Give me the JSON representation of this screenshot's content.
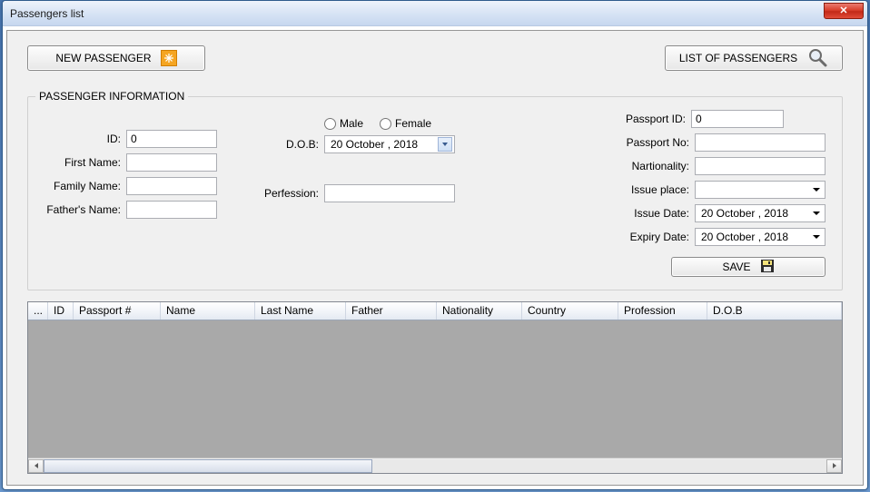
{
  "window": {
    "title": "Passengers list"
  },
  "toolbar": {
    "new_passenger": "NEW PASSENGER",
    "list_of_passengers": "LIST OF PASSENGERS"
  },
  "group": {
    "title": "PASSENGER INFORMATION"
  },
  "labels": {
    "id": "ID:",
    "first_name": "First Name:",
    "family_name": "Family Name:",
    "fathers_name": "Father's Name:",
    "dob": "D.O.B:",
    "profession": "Perfession:",
    "male": "Male",
    "female": "Female",
    "passport_id": "Passport ID:",
    "passport_no": "Passport No:",
    "nationality": "Nartionality:",
    "issue_place": "Issue place:",
    "issue_date": "Issue Date:",
    "expiry_date": "Expiry Date:",
    "save": "SAVE"
  },
  "values": {
    "id": "0",
    "first_name": "",
    "family_name": "",
    "fathers_name": "",
    "dob": "20  October  , 2018",
    "profession": "",
    "passport_id": "0",
    "passport_no": "",
    "nationality": "",
    "issue_place": "",
    "issue_date": "20  October  , 2018",
    "expiry_date": "20  October  , 2018"
  },
  "grid": {
    "columns": [
      "...",
      "ID",
      "Passport #",
      "Name",
      "Last Name",
      "Father",
      "Nationality",
      "Country",
      "Profession",
      "D.O.B"
    ]
  }
}
